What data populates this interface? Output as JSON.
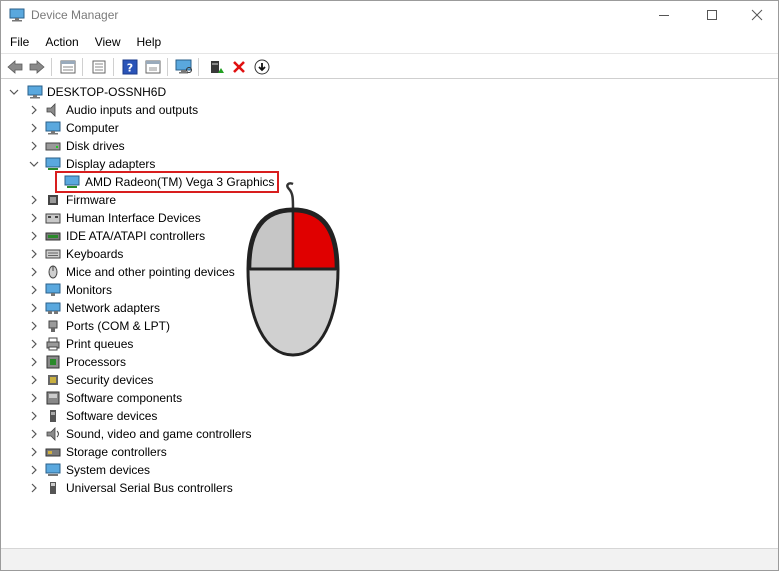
{
  "window": {
    "title": "Device Manager"
  },
  "menu": [
    "File",
    "Action",
    "View",
    "Help"
  ],
  "toolbar": {
    "buttons": [
      "back-icon",
      "forward-icon",
      "properties-view-icon",
      "details-view-icon",
      "help-icon",
      "show-hidden-icon",
      "monitor-scan-icon",
      "update-driver-icon",
      "uninstall-icon",
      "download-icon"
    ]
  },
  "tree": {
    "root": "DESKTOP-OSSNH6D",
    "categories": [
      "Audio inputs and outputs",
      "Computer",
      "Disk drives",
      "Display adapters",
      "Firmware",
      "Human Interface Devices",
      "IDE ATA/ATAPI controllers",
      "Keyboards",
      "Mice and other pointing devices",
      "Monitors",
      "Network adapters",
      "Ports (COM & LPT)",
      "Print queues",
      "Processors",
      "Security devices",
      "Software components",
      "Software devices",
      "Sound, video and game controllers",
      "Storage controllers",
      "System devices",
      "Universal Serial Bus controllers"
    ],
    "display_child": "AMD Radeon(TM) Vega 3 Graphics"
  },
  "colors": {
    "highlight": "#d81e1e",
    "mouse_right_button": "#e00000"
  }
}
